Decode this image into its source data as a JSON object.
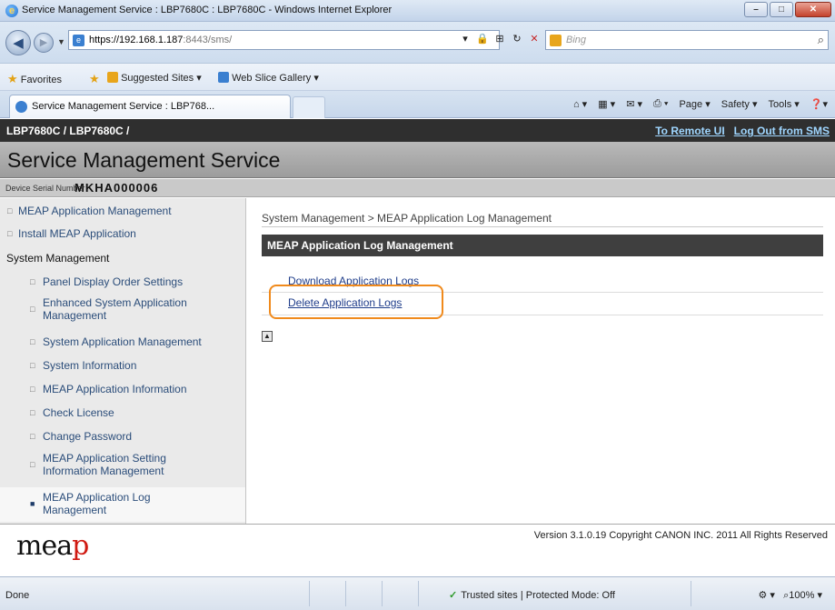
{
  "window": {
    "title": "Service Management Service : LBP7680C : LBP7680C - Windows Internet Explorer",
    "controls": [
      "–",
      "□",
      "✕"
    ]
  },
  "address_bar": {
    "url_main": "https://192.168.1.187",
    "url_rest": ":8443/sms/",
    "search_placeholder": "Bing"
  },
  "favorites_bar": {
    "favorites_label": "Favorites",
    "suggested_sites": "Suggested Sites ▾",
    "web_slice_gallery": "Web Slice Gallery ▾"
  },
  "tab": {
    "label": "Service Management Service : LBP768..."
  },
  "command_bar": {
    "page": "Page ▾",
    "safety": "Safety ▾",
    "tools": "Tools ▾",
    "help": "❓▾"
  },
  "page_header": {
    "breadcrumb": "LBP7680C / LBP7680C /",
    "remote_ui_link": "To Remote UI",
    "logout_link": "Log Out from SMS",
    "app_title": "Service Management Service",
    "serial_label": "Device Serial Number",
    "serial_value": "MKHA000006"
  },
  "sidebar": {
    "items": [
      {
        "label": "MEAP Application Management"
      },
      {
        "label": "Install MEAP Application"
      },
      {
        "label": "System Management"
      },
      {
        "label": "Panel Display Order Settings"
      },
      {
        "label_line1": "Enhanced System Application",
        "label_line2": "Management"
      },
      {
        "label": "System Application Management"
      },
      {
        "label": "System Information"
      },
      {
        "label": "MEAP Application Information"
      },
      {
        "label": "Check License"
      },
      {
        "label": "Change Password"
      },
      {
        "label_line1": "MEAP Application Setting",
        "label_line2": "Information Management"
      },
      {
        "label_line1": "MEAP Application Log",
        "label_line2": "Management"
      }
    ]
  },
  "content": {
    "path": "System Management > MEAP Application Log Management",
    "section_title": "MEAP Application Log Management",
    "links": [
      {
        "label": "Download Application Logs"
      },
      {
        "label": "Delete Application Logs"
      }
    ]
  },
  "footer": {
    "logo": "mea",
    "logo_p": "p",
    "version": "Version 3.1.0.19 Copyright CANON INC. 2011 All Rights Reserved"
  },
  "status_bar": {
    "status": "Done",
    "zone": "Trusted sites | Protected Mode: Off",
    "zoom": "100%"
  },
  "colors": {
    "highlight": "#f08a1c",
    "link": "#1f3d8a",
    "header_bg": "#3f3f3f"
  }
}
